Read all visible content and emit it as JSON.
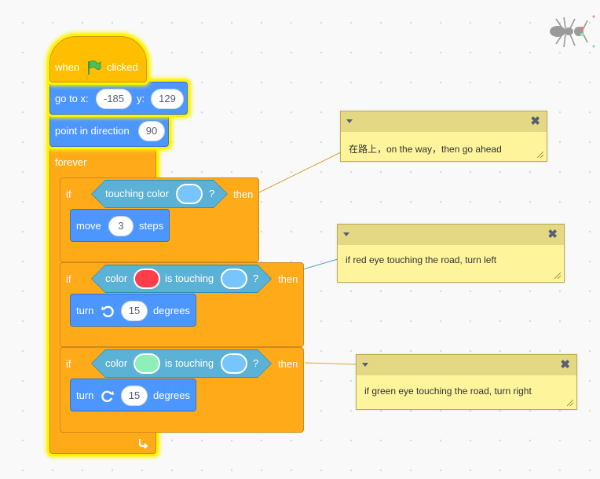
{
  "script": {
    "hat": {
      "when": "when",
      "clicked": "clicked"
    },
    "goto": {
      "label": "go to x:",
      "x": "-185",
      "y_label": "y:",
      "y": "129"
    },
    "point": {
      "label": "point in direction",
      "value": "90"
    },
    "forever": {
      "label": "forever"
    },
    "if1": {
      "if": "if",
      "then": "then",
      "condition": {
        "label": "touching color",
        "q": "?",
        "color": "#77c5ff"
      },
      "move": {
        "label": "move",
        "value": "3",
        "unit": "steps"
      }
    },
    "if2": {
      "if": "if",
      "then": "then",
      "condition": {
        "color_label": "color",
        "color1": "#ff3e4a",
        "is_touching": "is touching",
        "color2": "#77c5ff",
        "q": "?"
      },
      "turn": {
        "label": "turn",
        "icon": "rotate-left-icon",
        "value": "15",
        "unit": "degrees"
      }
    },
    "if3": {
      "if": "if",
      "then": "then",
      "condition": {
        "color_label": "color",
        "color1": "#8ef0b8",
        "is_touching": "is touching",
        "color2": "#77c5ff",
        "q": "?"
      },
      "turn": {
        "label": "turn",
        "icon": "rotate-right-icon",
        "value": "15",
        "unit": "degrees"
      }
    }
  },
  "comments": [
    {
      "text": "在路上，on the way，then go ahead",
      "close": "✖"
    },
    {
      "text": "if red eye touching the road, turn left",
      "close": "✖"
    },
    {
      "text": "if green eye touching the road, turn right",
      "close": "✖"
    }
  ],
  "sprite_icon": "ant-icon",
  "colors": {
    "control": "#ffab19",
    "events": "#ffbf00",
    "motion": "#4c97ff",
    "sensing": "#5cb1d6",
    "glow": "#fff200",
    "comment": "#fef49c"
  }
}
